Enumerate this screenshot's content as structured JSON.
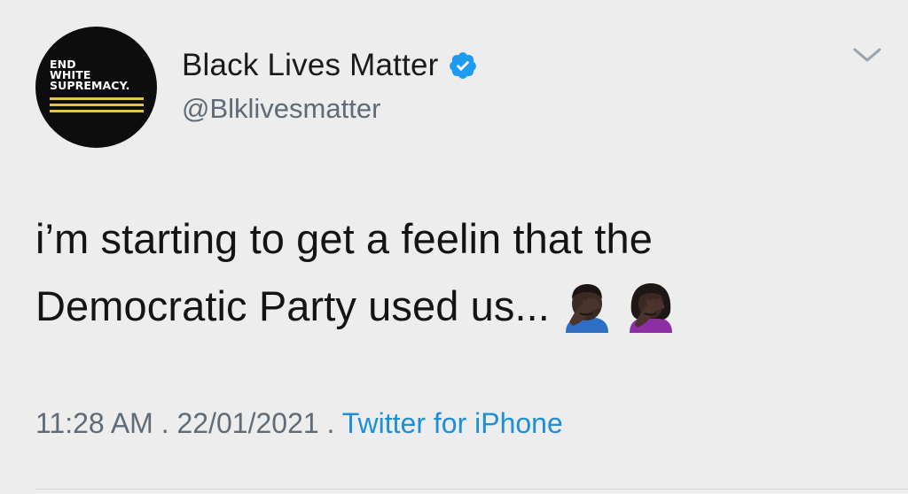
{
  "author": {
    "display_name": "Black Lives Matter",
    "handle": "@Blklivesmatter",
    "verified": true,
    "avatar_text": [
      "END",
      "WHITE",
      "SUPREMACY."
    ]
  },
  "tweet": {
    "text_line1": "i’m starting to get a feelin that the",
    "text_line2": "Democratic Party used us...",
    "emojis": [
      "man-facepalming-icon",
      "woman-facepalming-icon"
    ]
  },
  "meta": {
    "time": "11:28 AM",
    "sep1": " . ",
    "date": "22/01/2021",
    "sep2": " . ",
    "source": "Twitter for iPhone"
  },
  "colors": {
    "background": "#ededed",
    "verified_blue": "#1c9bf0",
    "link_blue": "#1c8fd8",
    "secondary_text": "#5f6b76",
    "avatar_stripe": "#e1c64a"
  }
}
